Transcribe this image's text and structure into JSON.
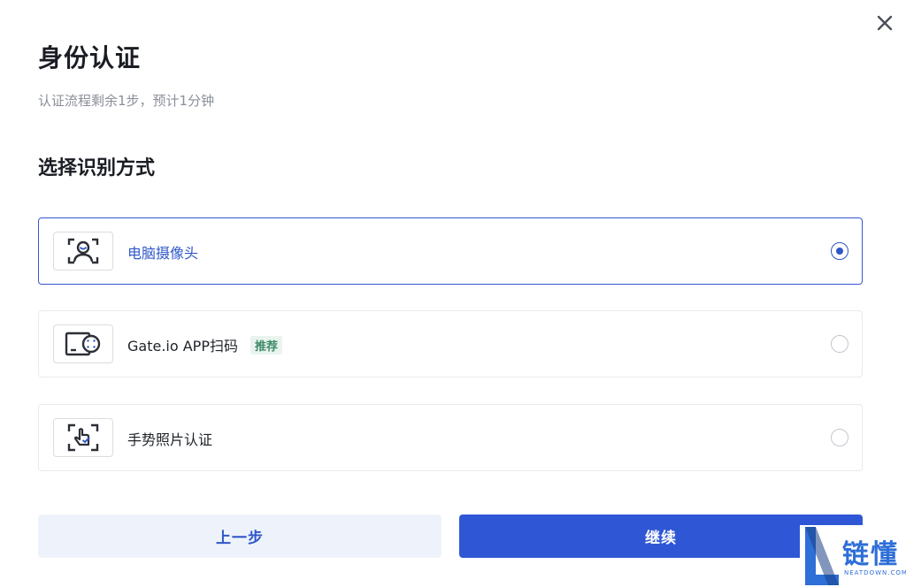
{
  "dialog": {
    "title": "身份认证",
    "subtitle": "认证流程剩余1步，预计1分钟",
    "section_title": "选择识别方式"
  },
  "options": [
    {
      "label": "电脑摄像头",
      "icon": "face-scan-icon",
      "selected": true
    },
    {
      "label": "Gate.io APP扫码",
      "badge": "推荐",
      "icon": "phone-scan-icon",
      "selected": false
    },
    {
      "label": "手势照片认证",
      "icon": "gesture-photo-icon",
      "selected": false
    }
  ],
  "buttons": {
    "prev_label": "上一步",
    "next_label": "继续"
  },
  "watermark": {
    "text": "链懂",
    "sub": "NEATDOWN.COM"
  },
  "colors": {
    "accent": "#2f57d5",
    "selected_border": "#3357d0",
    "badge_text": "#3f8a6a",
    "badge_bg": "#e9f4ef",
    "prev_bg": "#eef3fb"
  }
}
